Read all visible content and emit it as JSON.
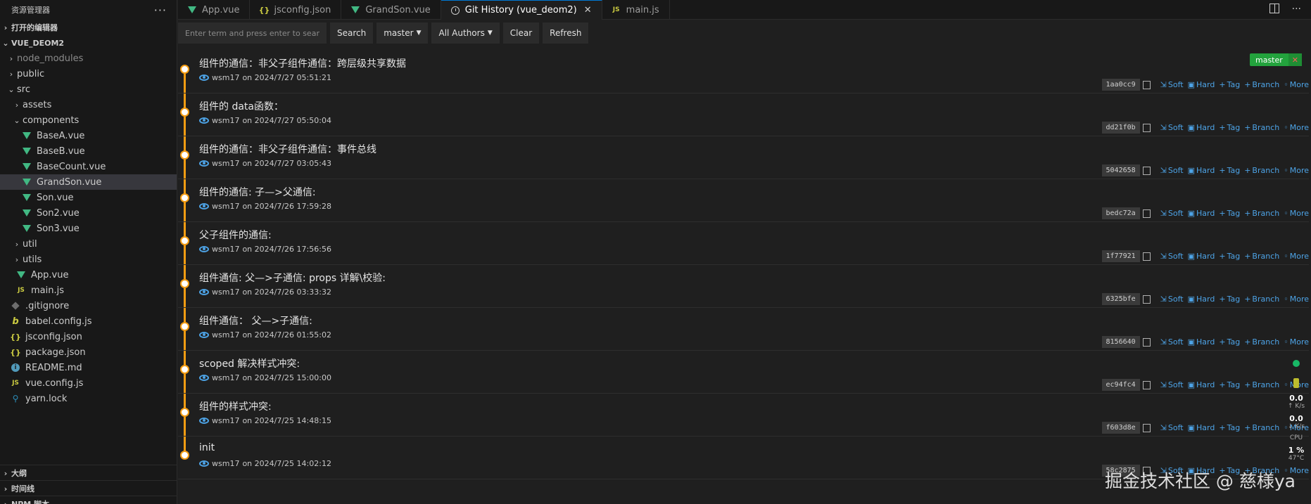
{
  "sidebar": {
    "title": "资源管理器",
    "more": "···",
    "open_editors": "打开的编辑器",
    "project": "VUE_DEOM2",
    "tree": [
      {
        "label": "node_modules",
        "kind": "folder",
        "depth": 1,
        "dim": true
      },
      {
        "label": "public",
        "kind": "folder",
        "depth": 1
      },
      {
        "label": "src",
        "kind": "folder-open",
        "depth": 1
      },
      {
        "label": "assets",
        "kind": "folder",
        "depth": 2
      },
      {
        "label": "components",
        "kind": "folder-open",
        "depth": 2
      },
      {
        "label": "BaseA.vue",
        "kind": "vue",
        "depth": 3
      },
      {
        "label": "BaseB.vue",
        "kind": "vue",
        "depth": 3
      },
      {
        "label": "BaseCount.vue",
        "kind": "vue",
        "depth": 3
      },
      {
        "label": "GrandSon.vue",
        "kind": "vue",
        "depth": 3,
        "selected": true
      },
      {
        "label": "Son.vue",
        "kind": "vue",
        "depth": 3
      },
      {
        "label": "Son2.vue",
        "kind": "vue",
        "depth": 3
      },
      {
        "label": "Son3.vue",
        "kind": "vue",
        "depth": 3
      },
      {
        "label": "util",
        "kind": "folder",
        "depth": 2
      },
      {
        "label": "utils",
        "kind": "folder",
        "depth": 2
      },
      {
        "label": "App.vue",
        "kind": "vue",
        "depth": 2
      },
      {
        "label": "main.js",
        "kind": "js",
        "depth": 2
      },
      {
        "label": ".gitignore",
        "kind": "git",
        "depth": 1
      },
      {
        "label": "babel.config.js",
        "kind": "babel",
        "depth": 1
      },
      {
        "label": "jsconfig.json",
        "kind": "json",
        "depth": 1
      },
      {
        "label": "package.json",
        "kind": "json",
        "depth": 1
      },
      {
        "label": "README.md",
        "kind": "info",
        "depth": 1
      },
      {
        "label": "vue.config.js",
        "kind": "js",
        "depth": 1
      },
      {
        "label": "yarn.lock",
        "kind": "yarn",
        "depth": 1
      }
    ],
    "outline": "大纲",
    "timeline": "时间线",
    "npm_scripts": "NPM 脚本"
  },
  "tabs": [
    {
      "label": "App.vue",
      "icon": "vue-icon"
    },
    {
      "label": "jsconfig.json",
      "icon": "json-icon"
    },
    {
      "label": "GrandSon.vue",
      "icon": "vue-icon"
    },
    {
      "label": "Git History (vue_deom2)",
      "icon": "history-icon",
      "active": true,
      "close": "✕"
    },
    {
      "label": "main.js",
      "icon": "js-icon"
    }
  ],
  "toolbar": {
    "search_placeholder": "Enter term and press enter to search",
    "search_label": "Search",
    "branch_label": "master",
    "authors_label": "All Authors",
    "clear_label": "Clear",
    "refresh_label": "Refresh"
  },
  "commit_actions": {
    "soft": "Soft",
    "hard": "Hard",
    "tag": "Tag",
    "branch": "Branch",
    "more": "More"
  },
  "branch_badge": {
    "label": "master",
    "close": "✕"
  },
  "commits": [
    {
      "message": "组件的通信：非父子组件通信：跨层级共享数据",
      "author": "wsm17",
      "date": "on 2024/7/27 05:51:21",
      "hash": "1aa0cc9",
      "branch": true
    },
    {
      "message": "组件的 data函数：",
      "author": "wsm17",
      "date": "on 2024/7/27 05:50:04",
      "hash": "dd21f0b"
    },
    {
      "message": "组件的通信：非父子组件通信：事件总线",
      "author": "wsm17",
      "date": "on 2024/7/27 03:05:43",
      "hash": "5042658"
    },
    {
      "message": "组件的通信: 子—>父通信:",
      "author": "wsm17",
      "date": "on 2024/7/26 17:59:28",
      "hash": "bedc72a"
    },
    {
      "message": "父子组件的通信:",
      "author": "wsm17",
      "date": "on 2024/7/26 17:56:56",
      "hash": "1f77921"
    },
    {
      "message": "组件通信: 父—>子通信: props 详解\\校验:",
      "author": "wsm17",
      "date": "on 2024/7/26 03:33:32",
      "hash": "6325bfe"
    },
    {
      "message": "组件通信： 父—>子通信:",
      "author": "wsm17",
      "date": "on 2024/7/26 01:55:02",
      "hash": "8156640"
    },
    {
      "message": "scoped 解决样式冲突:",
      "author": "wsm17",
      "date": "on 2024/7/25 15:00:00",
      "hash": "ec94fc4"
    },
    {
      "message": "组件的样式冲突:",
      "author": "wsm17",
      "date": "on 2024/7/25 14:48:15",
      "hash": "f603d8e"
    },
    {
      "message": "init",
      "author": "wsm17",
      "date": "on 2024/7/25 14:02:12",
      "hash": "58c2875"
    }
  ],
  "monitor": {
    "net_up": "0.0",
    "net_up_unit": "↑ K/s",
    "net_down": "0.0",
    "net_down_unit": "↓ K/s",
    "cpu_label": "CPU",
    "cpu_value": "1 %",
    "temp": "47°C"
  },
  "watermark": "掘金技术社区 @ 慈様ya",
  "colors": {
    "accent": "#0078d4",
    "graph": "#f39c12",
    "link": "#4da3e6",
    "branch": "#23a33d"
  }
}
